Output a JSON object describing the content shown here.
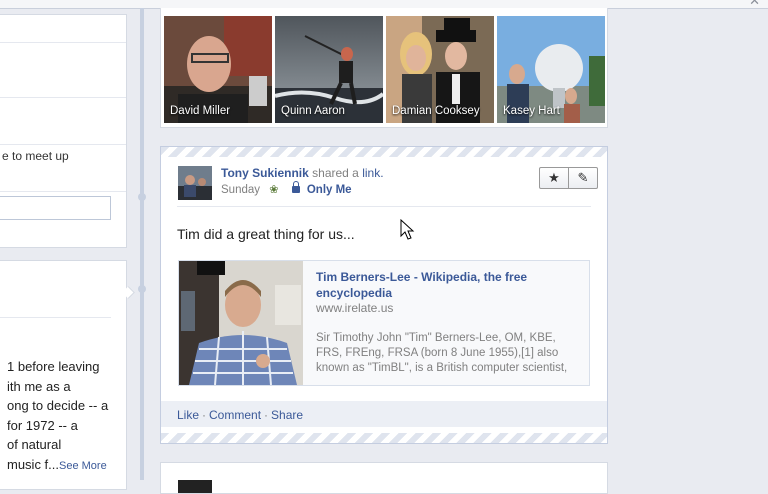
{
  "left_column": {
    "fragment_line": "e to meet up",
    "story_lines": [
      "1 before leaving",
      "ith me as a",
      "ong to decide -- a",
      "for 1972 -- a",
      "of natural",
      "music f..."
    ],
    "see_more": "See More"
  },
  "photos": [
    {
      "name": "David Miller"
    },
    {
      "name": "Quinn Aaron"
    },
    {
      "name": "Damian Cooksey"
    },
    {
      "name": "Kasey Hart"
    }
  ],
  "post": {
    "author": "Tony Sukiennik",
    "action_text": "shared a",
    "action_link": "link.",
    "date": "Sunday",
    "privacy": "Only Me",
    "status_text": "Tim did a great thing for us...",
    "link": {
      "title": "Tim Berners-Lee - Wikipedia, the free encyclopedia",
      "url": "www.irelate.us",
      "description": "Sir Timothy John \"Tim\" Berners-Lee, OM, KBE, FRS, FREng, FRSA (born 8 June 1955),[1] also known as \"TimBL\", is a British computer scientist,"
    },
    "feedback": {
      "like": "Like",
      "comment": "Comment",
      "share": "Share",
      "separator": "·"
    },
    "buttons": {
      "star_icon": "★",
      "pencil_icon": "✎"
    }
  },
  "colors": {
    "link_blue": "#3b5998",
    "page_bg": "#e9ebf1",
    "feedback_bg": "#eceff5"
  }
}
